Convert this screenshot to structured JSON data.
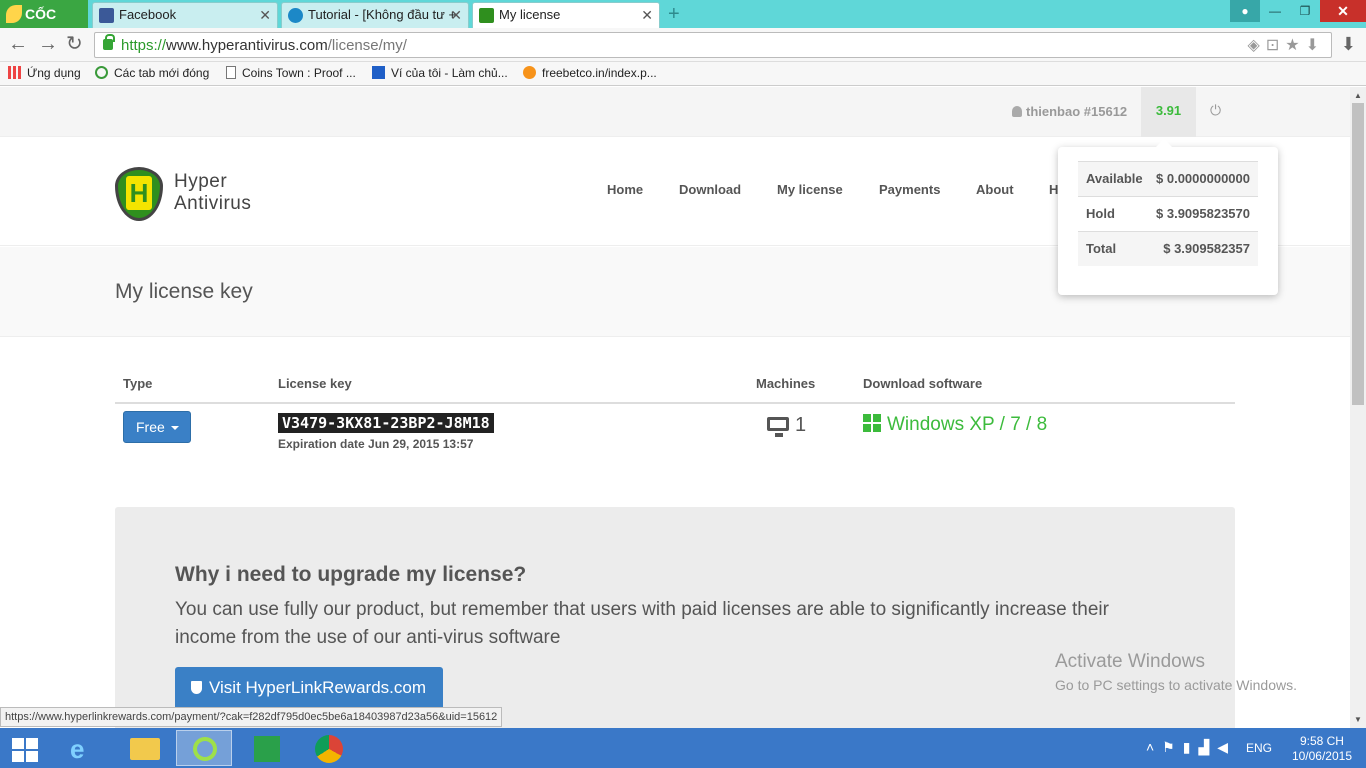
{
  "browser": {
    "brand": "CỐC CỐC",
    "tabs": [
      {
        "label": "Facebook",
        "icon": "facebook-icon",
        "color": "#3b5998"
      },
      {
        "label": "Tutorial - [Không đầu tư +",
        "icon": "tutorial-icon",
        "color": "#1c88c7"
      },
      {
        "label": "My license",
        "icon": "hyper-shield-icon",
        "color": "#2f8f1e"
      }
    ],
    "url_proto": "https://",
    "url_host": "www.hyperantivirus.com",
    "url_path": "/license/my/",
    "bookmarks": [
      {
        "label": "Ứng dụng",
        "icon": "apps-grid-icon"
      },
      {
        "label": "Các tab mới đóng",
        "icon": "recent-tabs-icon"
      },
      {
        "label": "Coins Town : Proof ...",
        "icon": "page-icon"
      },
      {
        "label": "Ví của tôi - Làm chủ...",
        "icon": "wallet-cube-icon"
      },
      {
        "label": "freebetco.in/index.p...",
        "icon": "bitcoin-icon"
      }
    ]
  },
  "site": {
    "user": "thienbao #15612",
    "balance": "3.91",
    "logo_line1": "Hyper",
    "logo_line2": "Antivirus",
    "nav": [
      "Home",
      "Download",
      "My license",
      "Payments",
      "About",
      "H"
    ],
    "page_title": "My license key",
    "wallet": {
      "rows": [
        {
          "label": "Available",
          "value": "$ 0.0000000000"
        },
        {
          "label": "Hold",
          "value": "$ 3.9095823570"
        },
        {
          "label": "Total",
          "value": "$ 3.909582357"
        }
      ]
    },
    "table": {
      "headers": [
        "Type",
        "License key",
        "Machines",
        "Download software"
      ],
      "row": {
        "type": "Free",
        "key": "V3479-3KX81-23BP2-J8M18",
        "expiry": "Expiration date Jun 29, 2015 13:57",
        "machines": "1",
        "download": "Windows XP / 7 / 8"
      }
    },
    "upgrade": {
      "title": "Why i need to upgrade my license?",
      "body": "You can use fully our product, but remember that users with paid licenses are able to significantly increase their income from the use of our anti-virus software",
      "button": "Visit HyperLinkRewards.com"
    }
  },
  "overlay": {
    "activate_title": "Activate Windows",
    "activate_sub": "Go to PC settings to activate Windows.",
    "status_url": "https://www.hyperlinkrewards.com/payment/?cak=f282df795d0ec5be6a18403987d23a56&uid=15612"
  },
  "taskbar": {
    "lang": "ENG",
    "time": "9:58 CH",
    "date": "10/06/2015"
  },
  "colors": {
    "accent_blue": "#3a80c6",
    "success_green": "#3cbb3c",
    "tabbar": "#5fd7d8",
    "taskbar": "#3a78c8"
  }
}
